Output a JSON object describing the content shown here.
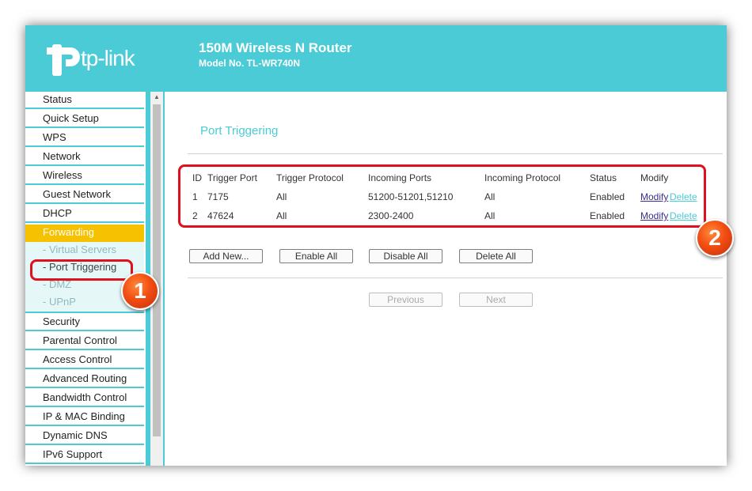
{
  "header": {
    "logo_text": "tp-link",
    "router_title": "150M Wireless N Router",
    "router_model": "Model No. TL-WR740N"
  },
  "sidebar": {
    "items": [
      {
        "label": "Status"
      },
      {
        "label": "Quick Setup"
      },
      {
        "label": "WPS"
      },
      {
        "label": "Network"
      },
      {
        "label": "Wireless"
      },
      {
        "label": "Guest Network"
      },
      {
        "label": "DHCP"
      },
      {
        "label": "Forwarding"
      },
      {
        "label": "- Virtual Servers"
      },
      {
        "label": "- Port Triggering"
      },
      {
        "label": "- DMZ"
      },
      {
        "label": "- UPnP"
      },
      {
        "label": "Security"
      },
      {
        "label": "Parental Control"
      },
      {
        "label": "Access Control"
      },
      {
        "label": "Advanced Routing"
      },
      {
        "label": "Bandwidth Control"
      },
      {
        "label": "IP & MAC Binding"
      },
      {
        "label": "Dynamic DNS"
      },
      {
        "label": "IPv6 Support"
      }
    ]
  },
  "main": {
    "title": "Port Triggering",
    "table": {
      "headers": [
        "ID",
        "Trigger Port",
        "Trigger Protocol",
        "Incoming Ports",
        "Incoming Protocol",
        "Status",
        "Modify"
      ],
      "rows": [
        {
          "id": "1",
          "trigger_port": "7175",
          "trigger_protocol": "All",
          "incoming_ports": "51200-51201,51210",
          "incoming_protocol": "All",
          "status": "Enabled",
          "modify": "Modify",
          "delete": "Delete"
        },
        {
          "id": "2",
          "trigger_port": "47624",
          "trigger_protocol": "All",
          "incoming_ports": "2300-2400",
          "incoming_protocol": "All",
          "status": "Enabled",
          "modify": "Modify",
          "delete": "Delete"
        }
      ]
    },
    "buttons": {
      "add_new": "Add New...",
      "enable_all": "Enable All",
      "disable_all": "Disable All",
      "delete_all": "Delete All",
      "previous": "Previous",
      "next": "Next"
    }
  },
  "annotations": {
    "badge_1": "1",
    "badge_2": "2"
  },
  "colors": {
    "brand": "#4acbd6",
    "active_menu": "#f5c100",
    "highlight": "#e0101e",
    "badge": "#f24d12"
  }
}
